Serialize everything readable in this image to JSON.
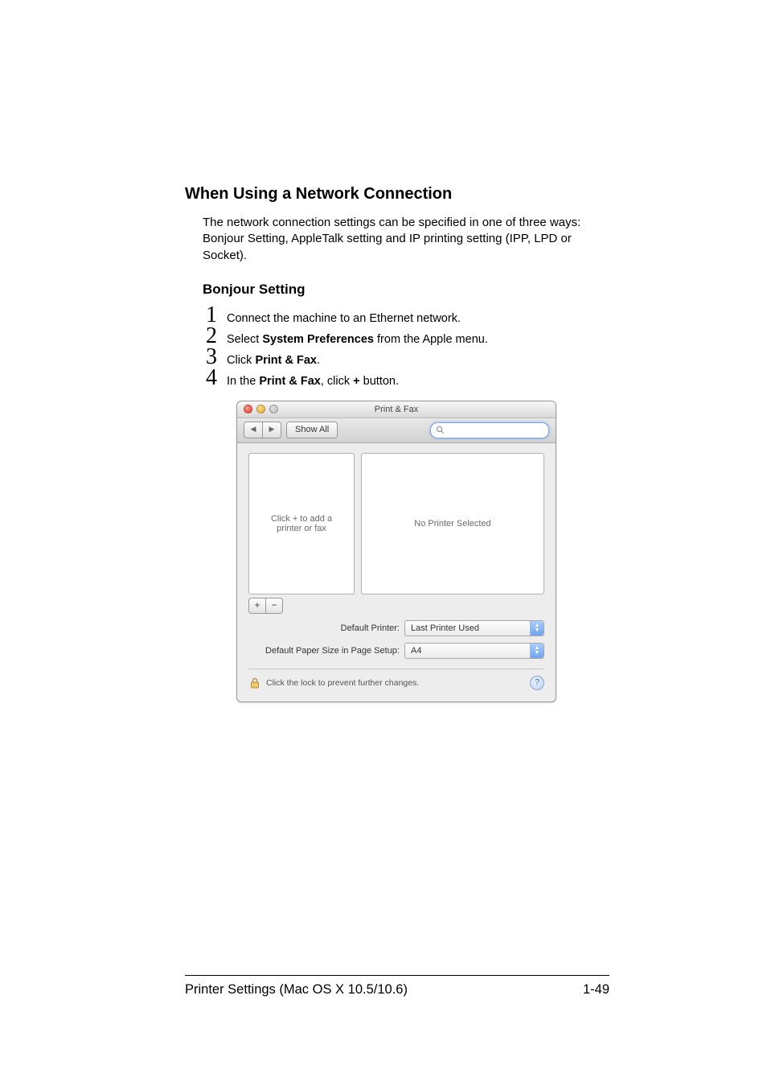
{
  "section_heading": "When Using a Network Connection",
  "section_body": "The network connection settings can be specified in one of three ways: Bonjour Setting, AppleTalk setting and IP printing setting (IPP, LPD or Socket).",
  "subsection_heading": "Bonjour Setting",
  "steps": {
    "s1": {
      "num": "1",
      "text_a": "Connect the machine to an Ethernet network."
    },
    "s2": {
      "num": "2",
      "text_a": "Select ",
      "bold": "System Preferences",
      "text_b": " from the Apple menu."
    },
    "s3": {
      "num": "3",
      "text_a": "Click ",
      "bold": "Print & Fax",
      "text_b": "."
    },
    "s4": {
      "num": "4",
      "text_a": "In the ",
      "bold": "Print & Fax",
      "text_b": ", click ",
      "bold2": "+",
      "text_c": " button."
    }
  },
  "screenshot": {
    "title": "Print & Fax",
    "nav_back": "◀",
    "nav_fwd": "▶",
    "show_all": "Show All",
    "search_placeholder": "",
    "left_panel_text": "Click + to add a\nprinter or fax",
    "right_panel_text": "No Printer Selected",
    "add_symbol": "+",
    "remove_symbol": "−",
    "row1_label": "Default Printer:",
    "row1_value": "Last Printer Used",
    "row2_label": "Default Paper Size in Page Setup:",
    "row2_value": "A4",
    "lock_text": "Click the lock to prevent further changes.",
    "help_symbol": "?"
  },
  "footer": {
    "left": "Printer Settings (Mac OS X 10.5/10.6)",
    "right": "1-49"
  }
}
